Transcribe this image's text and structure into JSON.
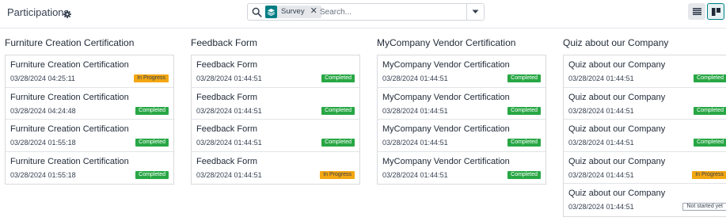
{
  "header": {
    "title": "Participations",
    "search": {
      "facet_label": "Survey",
      "placeholder": "Search..."
    }
  },
  "colors": {
    "accent": "#017e84",
    "completed": "#28a745",
    "in_progress": "#f3a712"
  },
  "icons": {
    "settings": "gear-icon",
    "search": "search-icon",
    "facet": "survey-stack-icon",
    "remove": "close-icon",
    "toggle": "caret-down-icon",
    "list_view": "list-icon",
    "kanban_view": "kanban-icon"
  },
  "columns": [
    {
      "title": "Furniture Creation Certification",
      "cards": [
        {
          "name": "Furniture Creation Certification",
          "date": "03/28/2024 04:25:11",
          "status": "In Progress",
          "status_key": "in-progress"
        },
        {
          "name": "Furniture Creation Certification",
          "date": "03/28/2024 04:24:48",
          "status": "Completed",
          "status_key": "completed"
        },
        {
          "name": "Furniture Creation Certification",
          "date": "03/28/2024 01:55:18",
          "status": "Completed",
          "status_key": "completed"
        },
        {
          "name": "Furniture Creation Certification",
          "date": "03/28/2024 01:55:18",
          "status": "Completed",
          "status_key": "completed"
        }
      ]
    },
    {
      "title": "Feedback Form",
      "cards": [
        {
          "name": "Feedback Form",
          "date": "03/28/2024 01:44:51",
          "status": "Completed",
          "status_key": "completed"
        },
        {
          "name": "Feedback Form",
          "date": "03/28/2024 01:44:51",
          "status": "Completed",
          "status_key": "completed"
        },
        {
          "name": "Feedback Form",
          "date": "03/28/2024 01:44:51",
          "status": "Completed",
          "status_key": "completed"
        },
        {
          "name": "Feedback Form",
          "date": "03/28/2024 01:44:51",
          "status": "In Progress",
          "status_key": "in-progress"
        }
      ]
    },
    {
      "title": "MyCompany Vendor Certification",
      "cards": [
        {
          "name": "MyCompany Vendor Certification",
          "date": "03/28/2024 01:44:51",
          "status": "Completed",
          "status_key": "completed"
        },
        {
          "name": "MyCompany Vendor Certification",
          "date": "03/28/2024 01:44:51",
          "status": "Completed",
          "status_key": "completed"
        },
        {
          "name": "MyCompany Vendor Certification",
          "date": "03/28/2024 01:44:51",
          "status": "Completed",
          "status_key": "completed"
        },
        {
          "name": "MyCompany Vendor Certification",
          "date": "03/28/2024 01:44:51",
          "status": "Completed",
          "status_key": "completed"
        }
      ]
    },
    {
      "title": "Quiz about our Company",
      "cards": [
        {
          "name": "Quiz about our Company",
          "date": "03/28/2024 01:44:51",
          "status": "Completed",
          "status_key": "completed"
        },
        {
          "name": "Quiz about our Company",
          "date": "03/28/2024 01:44:51",
          "status": "Completed",
          "status_key": "completed"
        },
        {
          "name": "Quiz about our Company",
          "date": "03/28/2024 01:44:51",
          "status": "Completed",
          "status_key": "completed"
        },
        {
          "name": "Quiz about our Company",
          "date": "03/28/2024 01:44:51",
          "status": "In Progress",
          "status_key": "in-progress"
        },
        {
          "name": "Quiz about our Company",
          "date": "03/28/2024 01:44:51",
          "status": "Not started yet",
          "status_key": "not-started"
        }
      ]
    }
  ]
}
